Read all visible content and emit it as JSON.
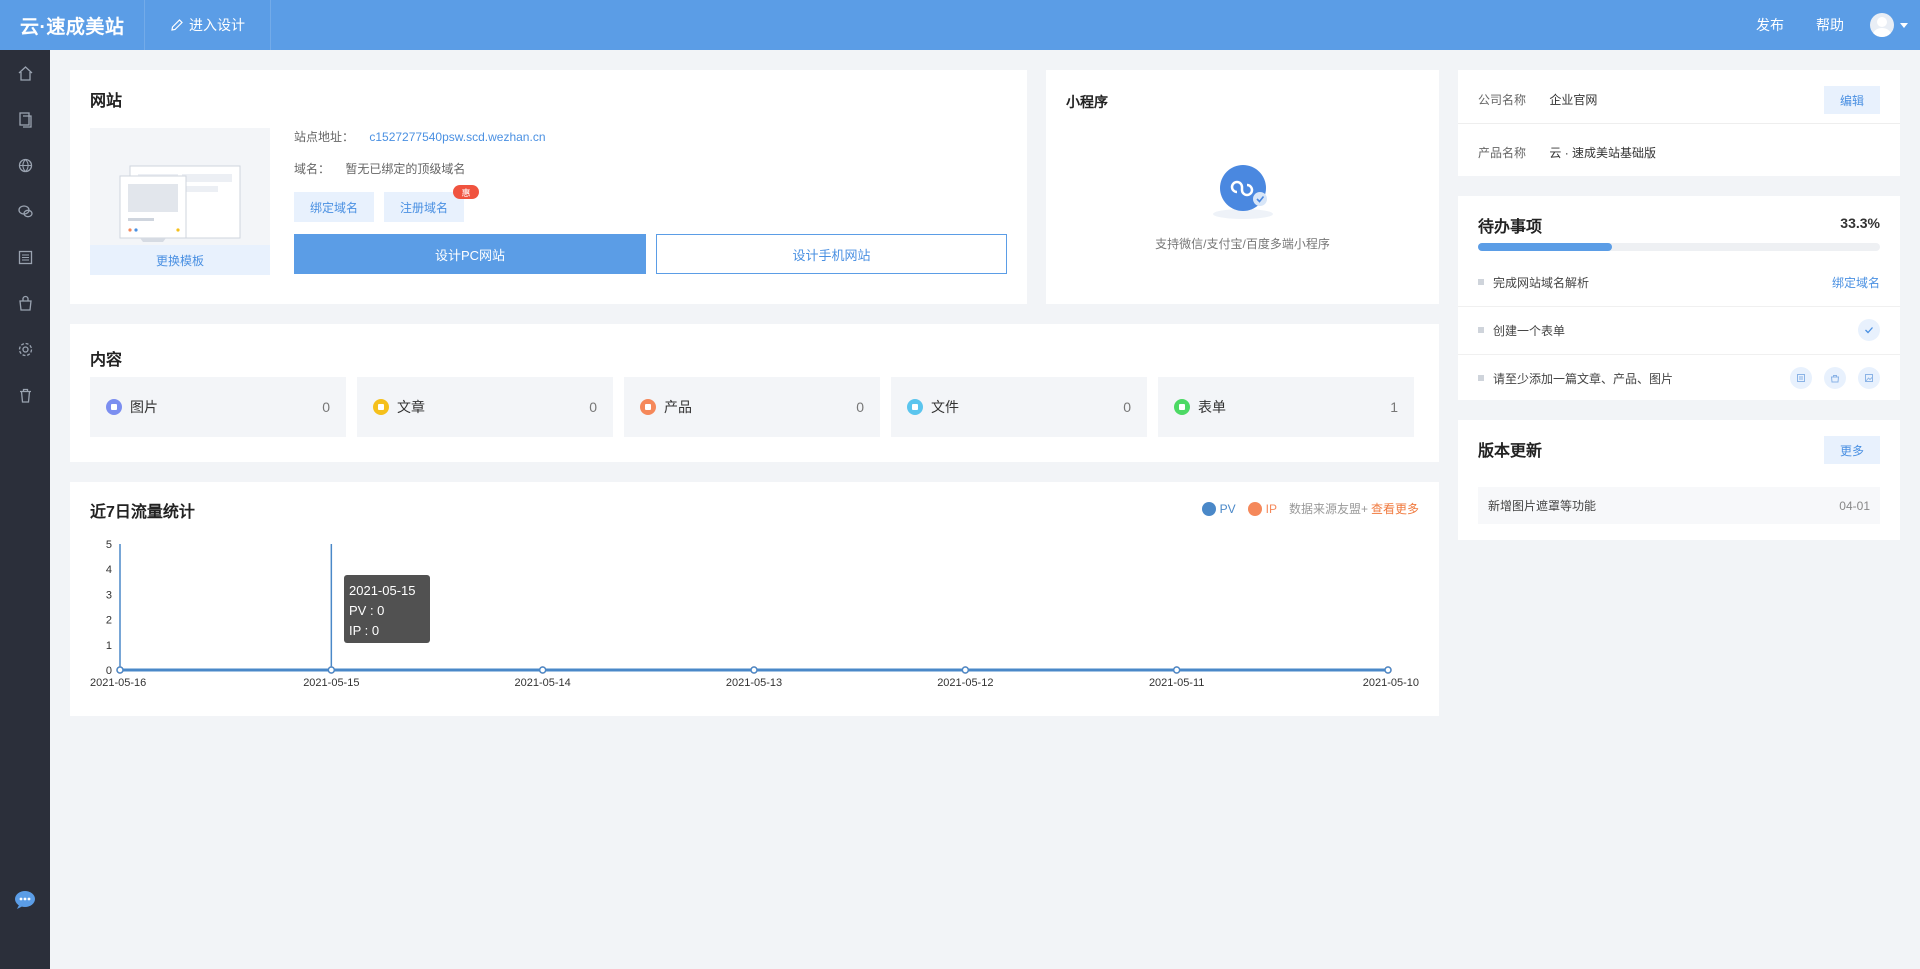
{
  "header": {
    "brand": "云·速成美站",
    "enter_design": "进入设计",
    "publish": "发布",
    "help": "帮助"
  },
  "sidebar": {
    "items": [
      "home-icon",
      "pages-icon",
      "globe-icon",
      "wechat-icon",
      "article-icon",
      "shop-icon",
      "gear-icon",
      "trash-icon"
    ],
    "bottom": "chat-icon"
  },
  "website": {
    "title": "网站",
    "change_template": "更换模板",
    "site_address_label": "站点地址：",
    "site_address": "c1527277540psw.scd.wezhan.cn",
    "domain_label": "域名：",
    "domain_value": "暂无已绑定的顶级域名",
    "bind_domain": "绑定域名",
    "register_domain": "注册域名",
    "register_badge": "惠",
    "design_pc": "设计PC网站",
    "design_mobile": "设计手机网站"
  },
  "mini_program": {
    "title": "小程序",
    "description": "支持微信/支付宝/百度多端小程序"
  },
  "company": {
    "company_label": "公司名称",
    "company_value": "企业官网",
    "product_label": "产品名称",
    "product_value": "云 · 速成美站基础版",
    "edit": "编辑"
  },
  "todo": {
    "title": "待办事项",
    "percent_text": "33.3%",
    "progress": 0.333,
    "items": [
      {
        "label": "完成网站域名解析",
        "action": "绑定域名"
      },
      {
        "label": "创建一个表单"
      },
      {
        "label": "请至少添加一篇文章、产品、图片"
      }
    ]
  },
  "version": {
    "title": "版本更新",
    "more": "更多",
    "entry": "新增图片遮罩等功能",
    "entry_date": "04-01"
  },
  "content": {
    "title": "内容",
    "stats": [
      {
        "label": "图片",
        "count": "0",
        "color": "#7b8ef0"
      },
      {
        "label": "文章",
        "count": "0",
        "color": "#f5c01c"
      },
      {
        "label": "产品",
        "count": "0",
        "color": "#f5885a"
      },
      {
        "label": "文件",
        "count": "0",
        "color": "#5bc5ee"
      },
      {
        "label": "表单",
        "count": "1",
        "color": "#4cd964"
      }
    ]
  },
  "traffic": {
    "title": "近7日流量统计",
    "legend_pv": "PV",
    "legend_ip": "IP",
    "source": "数据来源友盟+",
    "view_more": "查看更多",
    "tooltip": {
      "date": "2021-05-15",
      "pv": "PV : 0",
      "ip": "IP : 0"
    }
  },
  "chart_data": {
    "type": "line",
    "x": [
      "2021-05-16",
      "2021-05-15",
      "2021-05-14",
      "2021-05-13",
      "2021-05-12",
      "2021-05-11",
      "2021-05-10"
    ],
    "series": [
      {
        "name": "PV",
        "values": [
          0,
          0,
          0,
          0,
          0,
          0,
          0
        ],
        "color": "#4a88c8"
      },
      {
        "name": "IP",
        "values": [
          0,
          0,
          0,
          0,
          0,
          0,
          0
        ],
        "color": "#f5885a"
      }
    ],
    "yticks": [
      0,
      1,
      2,
      3,
      4,
      5
    ],
    "ylim": [
      0,
      5
    ],
    "grid": false,
    "legend": "top-right"
  }
}
